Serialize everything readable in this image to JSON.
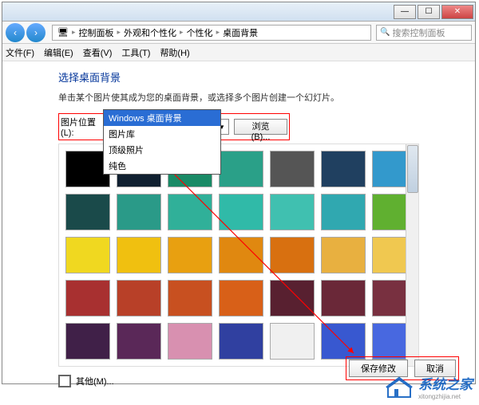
{
  "titlebar": {
    "min": "—",
    "max": "☐",
    "close": "✕"
  },
  "nav": {
    "back": "‹",
    "forward": "›",
    "breadcrumb": [
      "控制面板",
      "外观和个性化",
      "个性化",
      "桌面背景"
    ],
    "search_placeholder": "搜索控制面板"
  },
  "menu": {
    "file": "文件(F)",
    "edit": "编辑(E)",
    "view": "查看(V)",
    "tools": "工具(T)",
    "help": "帮助(H)"
  },
  "page": {
    "title": "选择桌面背景",
    "desc": "单击某个图片使其成为您的桌面背景，或选择多个图片创建一个幻灯片。",
    "picloc_label": "图片位置(L):",
    "picloc_value": "纯色",
    "browse": "浏览(B)...",
    "dropdown": [
      "Windows 桌面背景",
      "图片库",
      "顶级照片",
      "纯色"
    ],
    "other": "其他(M)...",
    "save": "保存修改",
    "cancel": "取消"
  },
  "swatches": [
    "#000000",
    "#102030",
    "#1a8a66",
    "#2aa088",
    "#555555",
    "#204060",
    "#3399cc",
    "#1a4a4a",
    "#2a9a88",
    "#30b099",
    "#30baa8",
    "#40c0b0",
    "#30a8b0",
    "#60b030",
    "#f0d820",
    "#f0c010",
    "#e8a010",
    "#e08810",
    "#d87010",
    "#e8b040",
    "#f0c850",
    "#a83030",
    "#b84028",
    "#c85020",
    "#d86018",
    "#582030",
    "#6a2838",
    "#783040",
    "#402048",
    "#5a2858",
    "#d890b0",
    "#3040a0",
    "#f0f0f0",
    "#3858d0",
    "#4868e0"
  ],
  "watermark": {
    "text": "系统之家",
    "url": "xitongzhijia.net"
  },
  "chart_data": null
}
